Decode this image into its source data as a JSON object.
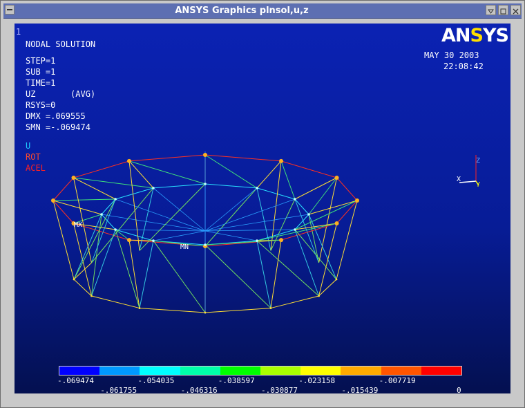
{
  "window": {
    "title": "ANSYS Graphics    plnsol,u,z",
    "buttons": [
      "minimize",
      "maximize",
      "close"
    ]
  },
  "plot": {
    "window_number": "1",
    "lines": [
      "NODAL SOLUTION",
      "",
      "STEP=1",
      "SUB =1",
      "TIME=1",
      "UZ       (AVG)",
      "RSYS=0",
      "DMX =.069555",
      "SMN =-.069474"
    ],
    "legend": {
      "u": "U",
      "rot": "ROT",
      "acel": "ACEL"
    },
    "date": "MAY 30 2003",
    "time": "22:08:42",
    "logo": {
      "part1": "AN",
      "accent": "S",
      "part2": "YS"
    },
    "labels": {
      "mn": "MN",
      "mx": "MX"
    },
    "triad": {
      "x": "X",
      "y": "Y",
      "z": "Z"
    }
  },
  "contour": {
    "colors": [
      "#0000ff",
      "#0099ff",
      "#00ffff",
      "#00ffaa",
      "#00ff00",
      "#aaff00",
      "#ffff00",
      "#ffaa00",
      "#ff5500",
      "#ff0000"
    ],
    "ticks_top": [
      "-.069474",
      "-.054035",
      "-.038597",
      "-.023158",
      "-.007719"
    ],
    "ticks_bottom": [
      "-.061755",
      "-.046316",
      "-.030877",
      "-.015439",
      "0"
    ]
  },
  "colors": {
    "titlebar": "#5d6fb2",
    "background_top": "#0b22b3",
    "background_bottom": "#041050",
    "mesh_outer": "#ffde33",
    "mesh_inner": "#29e0ff"
  }
}
